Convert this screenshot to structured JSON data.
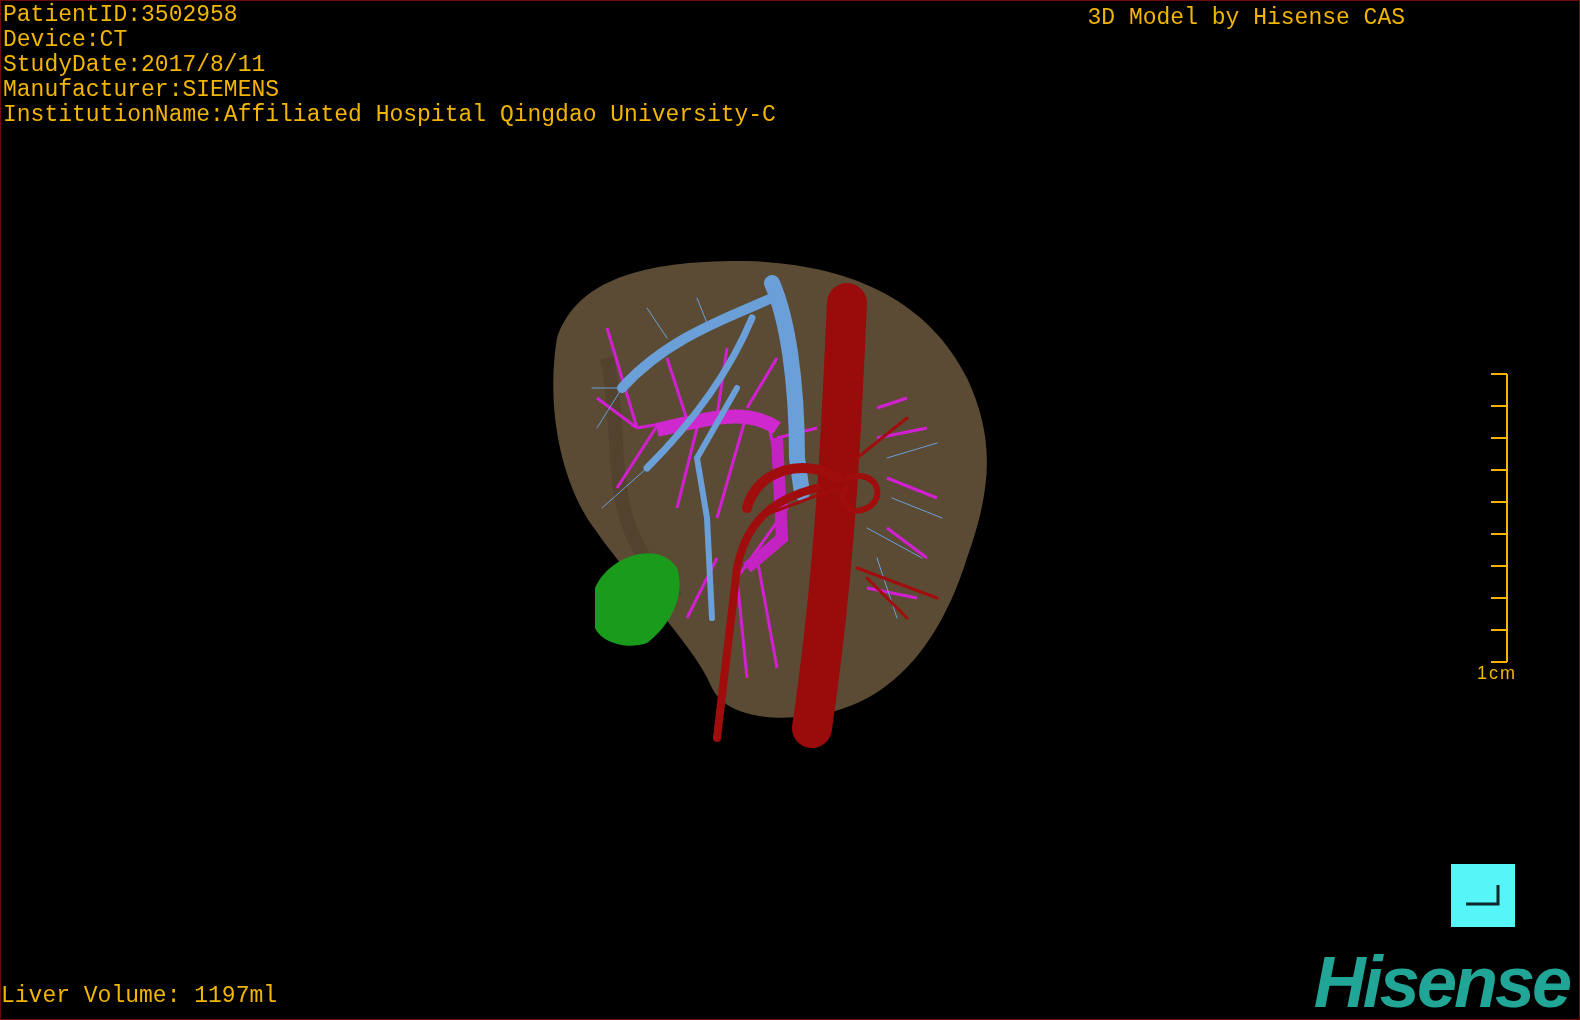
{
  "info_lines": [
    "PatientID:3502958",
    "Device:CT",
    "StudyDate:2017/8/11",
    "Manufacturer:SIEMENS",
    "InstitutionName:Affiliated Hospital Qingdao University-C"
  ],
  "title": "3D Model by Hisense CAS",
  "scale_bar": {
    "label": "1cm"
  },
  "liver_volume": "Liver Volume: 1197ml",
  "logo": "Hisense"
}
